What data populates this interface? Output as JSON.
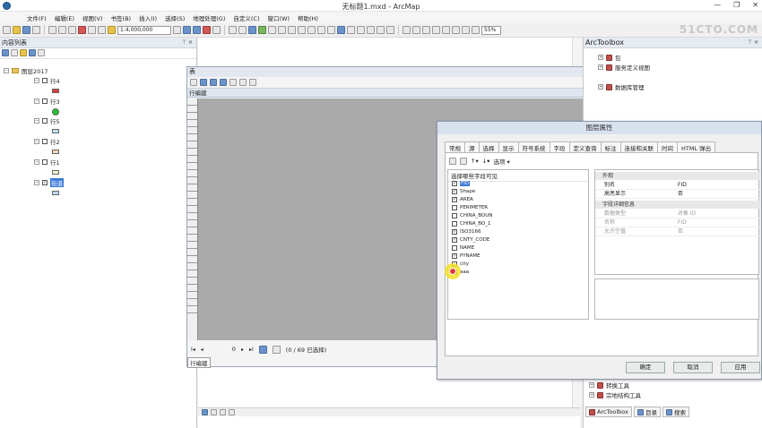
{
  "window": {
    "title": "无标题1.mxd - ArcMap",
    "buttons": [
      "—",
      "❐",
      "✕"
    ]
  },
  "watermark": "51CTO.COM",
  "menu": [
    "文件(F)",
    "编辑(E)",
    "视图(V)",
    "书签(B)",
    "插入(I)",
    "选择(S)",
    "地理处理(G)",
    "自定义(C)",
    "窗口(W)",
    "帮助(H)"
  ],
  "toolbar": {
    "scale": "1:4,000,000",
    "zoom": "55%"
  },
  "toc": {
    "title": "内容列表",
    "pin": "⊤ ✕",
    "root": "图层2017",
    "layers": [
      {
        "label": "行4",
        "checked": false,
        "symbol": "#e23b3b"
      },
      {
        "label": "行3",
        "checked": false,
        "symbol": "#1fc42a"
      },
      {
        "label": "行5",
        "checked": false,
        "symbol": "#bfe0f5"
      },
      {
        "label": "行2",
        "checked": false,
        "symbol": "#f3d4bd"
      },
      {
        "label": "行1",
        "checked": false,
        "symbol": "#f4f0c8"
      },
      {
        "label": "街道",
        "checked": true,
        "symbol": "#c5d5ef"
      }
    ]
  },
  "table": {
    "title": "表",
    "close": "□ ✕",
    "tab_name": "行编建",
    "nav": {
      "first": "I◂",
      "prev": "◂",
      "position": "0",
      "next": "▸",
      "last": "▸I",
      "status": "(0 / 69 已选择)"
    },
    "foot_tab": "行编建"
  },
  "layer_props": {
    "title": "图层属性",
    "tabs": [
      "常规",
      "源",
      "选择",
      "显示",
      "符号系统",
      "字段",
      "定义查询",
      "标注",
      "连接和关联",
      "时间",
      "HTML 弹出"
    ],
    "active_tab": "字段",
    "options_label": "选项 ▾",
    "field_list_header": "选择哪些字段可见",
    "fields": [
      {
        "name": "FID",
        "checked": true,
        "selected": true
      },
      {
        "name": "Shape",
        "checked": true
      },
      {
        "name": "AREA",
        "checked": true
      },
      {
        "name": "PERIMETER",
        "checked": false
      },
      {
        "name": "CHINA_BOUN",
        "checked": false
      },
      {
        "name": "CHINA_BO_1",
        "checked": false
      },
      {
        "name": "ISO3166",
        "checked": true
      },
      {
        "name": "CNTY_CODE",
        "checked": true
      },
      {
        "name": "NAME",
        "checked": false
      },
      {
        "name": "PYNAME",
        "checked": true
      },
      {
        "name": "city",
        "checked": false
      },
      {
        "name": "aaa",
        "checked": false
      }
    ],
    "prop_groups": [
      {
        "title": "外观",
        "rows": [
          {
            "key": "别名",
            "value": "FID"
          },
          {
            "key": "高亮显示",
            "value": "否"
          }
        ]
      },
      {
        "title": "字段详细信息",
        "rows": [
          {
            "key": "数据类型",
            "value": "对象 ID"
          },
          {
            "key": "名称",
            "value": "FID"
          },
          {
            "key": "允许空值",
            "value": "否"
          }
        ]
      }
    ],
    "buttons": {
      "ok": "确定",
      "cancel": "取消",
      "apply": "应用"
    }
  },
  "toolbox": {
    "title": "ArcToolbox",
    "pin": "⊤ ✕",
    "items": [
      {
        "label": "包",
        "top": true
      },
      {
        "label": "服务定义视图"
      },
      {
        "label": "数据库管理"
      },
      {
        "label": "转换工具"
      },
      {
        "label": "宗地结构工具"
      }
    ],
    "bottom_tabs": [
      "ArcToolbox",
      "目录",
      "搜索"
    ]
  }
}
